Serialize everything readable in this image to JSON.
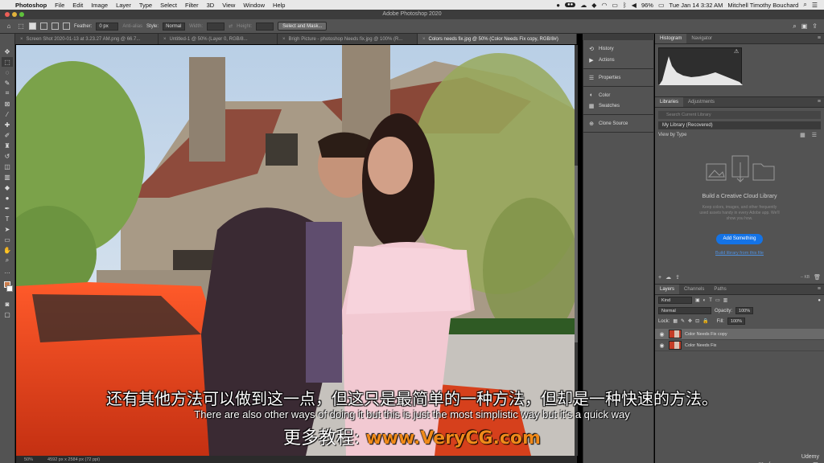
{
  "menubar": {
    "app": "Photoshop",
    "items": [
      "File",
      "Edit",
      "Image",
      "Layer",
      "Type",
      "Select",
      "Filter",
      "3D",
      "View",
      "Window",
      "Help"
    ],
    "battery": "96%",
    "datetime": "Tue Jan 14  3:32 AM",
    "user": "Mitchell Timothy Bouchard"
  },
  "titlebar": {
    "title": "Adobe Photoshop 2020"
  },
  "options": {
    "feather_label": "Feather:",
    "feather_value": "0 px",
    "antialias_label": "Anti-alias",
    "style_label": "Style:",
    "style_value": "Normal",
    "width_label": "Width:",
    "height_label": "Height:",
    "select_mask_label": "Select and Mask..."
  },
  "tabs": [
    {
      "label": "Screen Shot 2020-01-13 at 3.23.27 AM.png @ 66.7...",
      "active": false
    },
    {
      "label": "Untitled-1 @ 50% (Layer 0, RGB/8...",
      "active": false
    },
    {
      "label": "Brigh Picture - photoshop Needs fix.jpg @ 100% (R...",
      "active": false
    },
    {
      "label": "Colors needs fix.jpg @ 50% (Color Needs Fix copy, RGB/8#)",
      "active": true
    }
  ],
  "status": {
    "zoom": "50%",
    "doc_size": "4592 px x 2584 px (72 ppi)"
  },
  "strip": {
    "groups": [
      [
        "History",
        "Actions"
      ],
      [
        "Properties"
      ],
      [
        "Color",
        "Swatches"
      ],
      [
        "Clone Source"
      ]
    ]
  },
  "histogram_panel": {
    "tabs": [
      "Histogram",
      "Navigator"
    ]
  },
  "libraries_panel": {
    "tabs": [
      "Libraries",
      "Adjustments"
    ],
    "search_placeholder": "Search Current Library",
    "library_select": "My Library (Recovered)",
    "view_by": "View by Type",
    "cta_title": "Build a Creative Cloud Library",
    "cta_body": "Keep colors, images, and other frequently used assets handy in every Adobe app. We'll show you how.",
    "add_button": "Add Something",
    "build_link": "Build library from this file",
    "size_label": "-- KB"
  },
  "layers_panel": {
    "tabs": [
      "Layers",
      "Channels",
      "Paths"
    ],
    "kind": "Kind",
    "blend_mode": "Normal",
    "opacity_label": "Opacity:",
    "opacity_value": "100%",
    "lock_label": "Lock:",
    "fill_label": "Fill:",
    "fill_value": "100%",
    "layers": [
      {
        "name": "Color Needs Fix copy",
        "selected": true
      },
      {
        "name": "Color Needs Fix",
        "selected": false
      }
    ]
  },
  "subtitles": {
    "chinese": "还有其他方法可以做到这一点，但这只是最简单的一种方法，但却是一种快速的方法。",
    "english": "There are also other ways of doing it but this is just the most simplistic way but it's a quick way"
  },
  "watermark": {
    "label": "更多教程:",
    "url": "www.VeryCG.com"
  },
  "udemy": "Udemy"
}
